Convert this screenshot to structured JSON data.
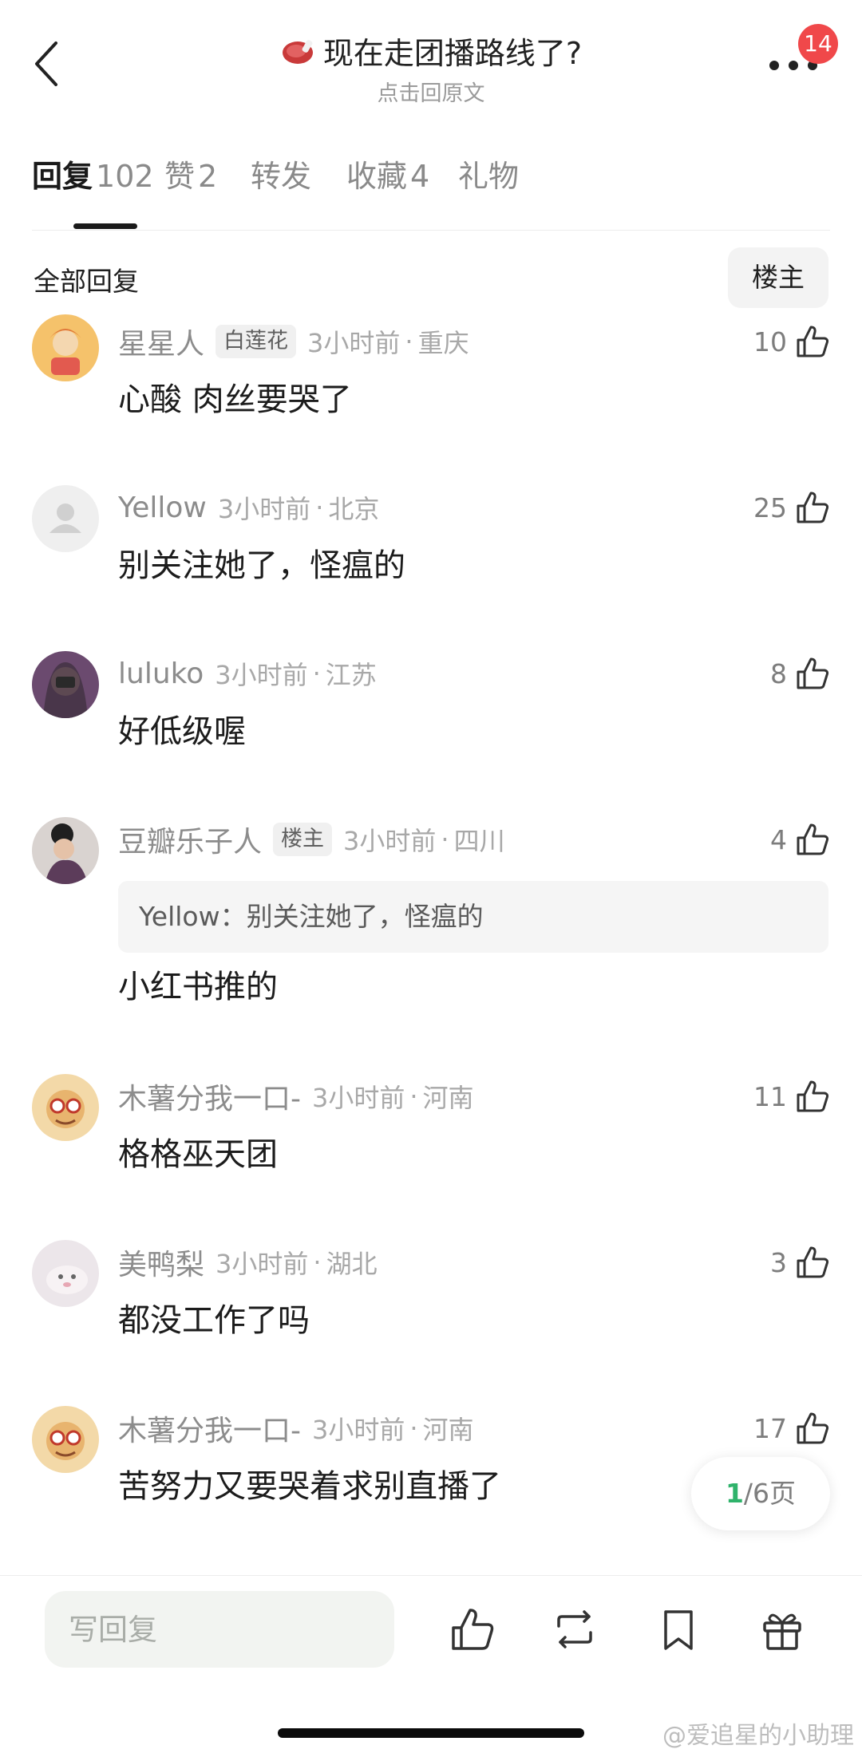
{
  "header": {
    "title": "现在走团播路线了?",
    "subtitle": "点击回原文",
    "notification_count": "14",
    "title_icon": "steak-emoji-icon"
  },
  "tabs": [
    {
      "label": "回复",
      "count": "102",
      "active": true
    },
    {
      "label": "赞",
      "count": "2"
    },
    {
      "label": "转发",
      "count": ""
    },
    {
      "label": "收藏",
      "count": "4"
    },
    {
      "label": "礼物",
      "count": ""
    }
  ],
  "section": {
    "title": "全部回复",
    "op_filter": "楼主"
  },
  "comments": [
    {
      "username": "星星人",
      "tag": "白莲花",
      "time": "3小时前",
      "location": "重庆",
      "likes": "10",
      "body": "心酸 肉丝要哭了"
    },
    {
      "username": "Yellow",
      "tag": "",
      "time": "3小时前",
      "location": "北京",
      "likes": "25",
      "body": "别关注她了，怪瘟的"
    },
    {
      "username": "luluko",
      "tag": "",
      "time": "3小时前",
      "location": "江苏",
      "likes": "8",
      "body": "好低级喔"
    },
    {
      "username": "豆瓣乐子人",
      "tag": "楼主",
      "time": "3小时前",
      "location": "四川",
      "likes": "4",
      "quote": "Yellow：别关注她了，怪瘟的",
      "body": "小红书推的"
    },
    {
      "username": "木薯分我一口-",
      "tag": "",
      "time": "3小时前",
      "location": "河南",
      "likes": "11",
      "body": "格格巫天团"
    },
    {
      "username": "美鸭梨",
      "tag": "",
      "time": "3小时前",
      "location": "湖北",
      "likes": "3",
      "body": "都没工作了吗"
    },
    {
      "username": "木薯分我一口-",
      "tag": "",
      "time": "3小时前",
      "location": "河南",
      "likes": "17",
      "body": "苦努力又要哭着求别直播了"
    }
  ],
  "pager": {
    "current": "1",
    "total_text": "/6页"
  },
  "bottom": {
    "reply_placeholder": "写回复",
    "watermark": "@爱追星的小助理"
  },
  "colors": {
    "accent_green": "#2fb36b",
    "badge_red": "#f0484a"
  }
}
